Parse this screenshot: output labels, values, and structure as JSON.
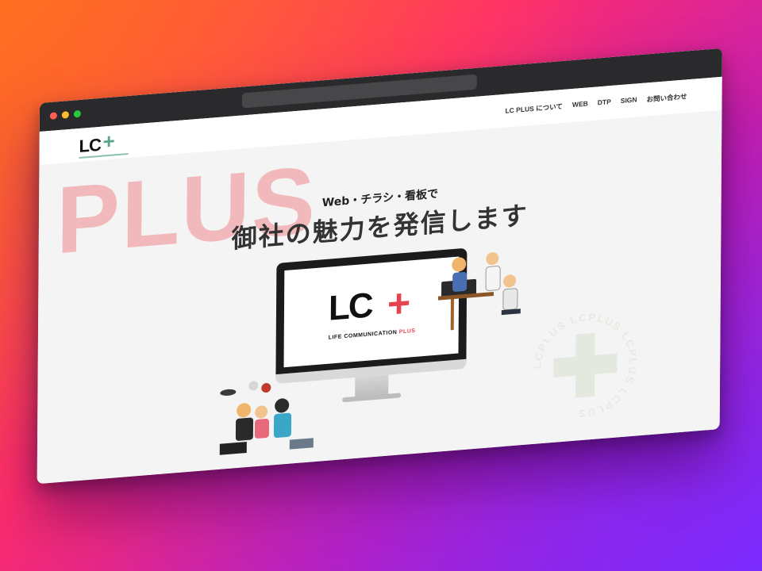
{
  "site": {
    "logo_text": "LC",
    "logo_plus": "+",
    "nav": [
      "LC PLUS について",
      "WEB",
      "DTP",
      "SIGN",
      "お問い合わせ"
    ]
  },
  "hero": {
    "background_word": "PLUS",
    "tagline": "Web・チラシ・看板で",
    "headline": "御社の魅力を発信します"
  },
  "monitor": {
    "logo_text": "LC",
    "logo_plus": "+",
    "subtitle_main": "LIFE COMMUNICATION",
    "subtitle_plus": "PLUS"
  },
  "badge": {
    "ring_text": "LCPLUS LCPLUS LCPLUS LCPLUS"
  },
  "colors": {
    "accent_red": "#e8424e",
    "accent_green": "#5aa58c",
    "plus_watermark": "#f2b9bd"
  }
}
